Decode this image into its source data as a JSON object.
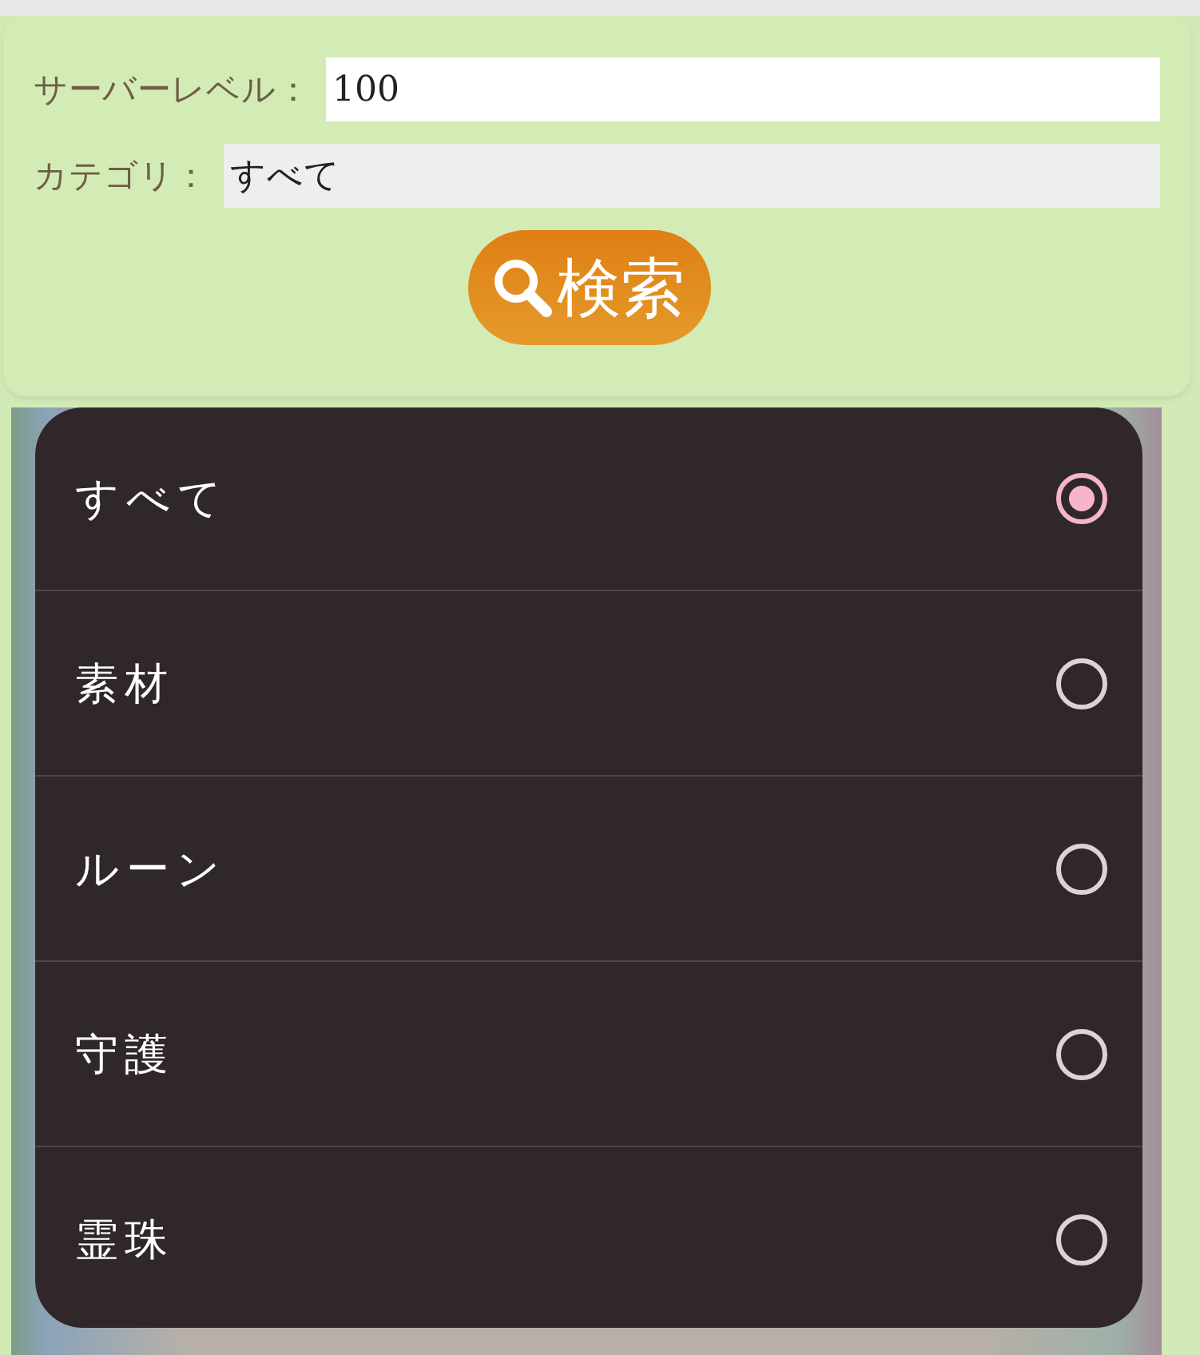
{
  "search_form": {
    "fields": [
      {
        "kind": "input",
        "label": "サーバーレベル：",
        "value": "100"
      },
      {
        "kind": "select",
        "label": "カテゴリ：",
        "value": "すべて"
      }
    ],
    "search_button": {
      "label": "検索"
    }
  },
  "category_picker": {
    "options": [
      {
        "label": "すべて",
        "selected": true
      },
      {
        "label": "素材",
        "selected": false
      },
      {
        "label": "ルーン",
        "selected": false
      },
      {
        "label": "守護",
        "selected": false
      },
      {
        "label": "霊珠",
        "selected": false
      }
    ]
  }
}
